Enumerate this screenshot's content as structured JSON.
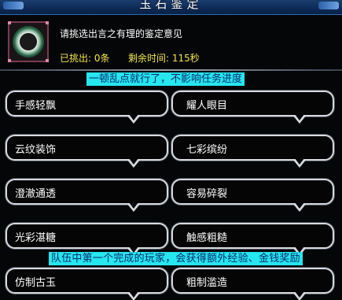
{
  "window": {
    "title": "玉石鉴定"
  },
  "header": {
    "prompt": "请挑选出言之有理的鉴定意见",
    "picked": "已挑出: 0条",
    "time_left": "剩余时间: 115秒",
    "item_icon": "jade-ring-icon"
  },
  "banners": {
    "top": "一顿乱点就行了，不影响任务进度",
    "bottom": "队伍中第一个完成的玩家，会获得额外经验、金钱奖励"
  },
  "options": [
    {
      "label": "手感轻飘"
    },
    {
      "label": "耀人眼目"
    },
    {
      "label": "云纹装饰"
    },
    {
      "label": "七彩缤纷"
    },
    {
      "label": "澄澈通透"
    },
    {
      "label": "容易碎裂"
    },
    {
      "label": "光彩湛糖"
    },
    {
      "label": "触感粗糙"
    },
    {
      "label": "仿制古玉"
    },
    {
      "label": "粗制滥造"
    }
  ],
  "colors": {
    "banner_bg": "#26e6ee",
    "banner_text": "#0a2a6e",
    "status_text": "#f2e64a",
    "border": "#d7dbe0"
  }
}
